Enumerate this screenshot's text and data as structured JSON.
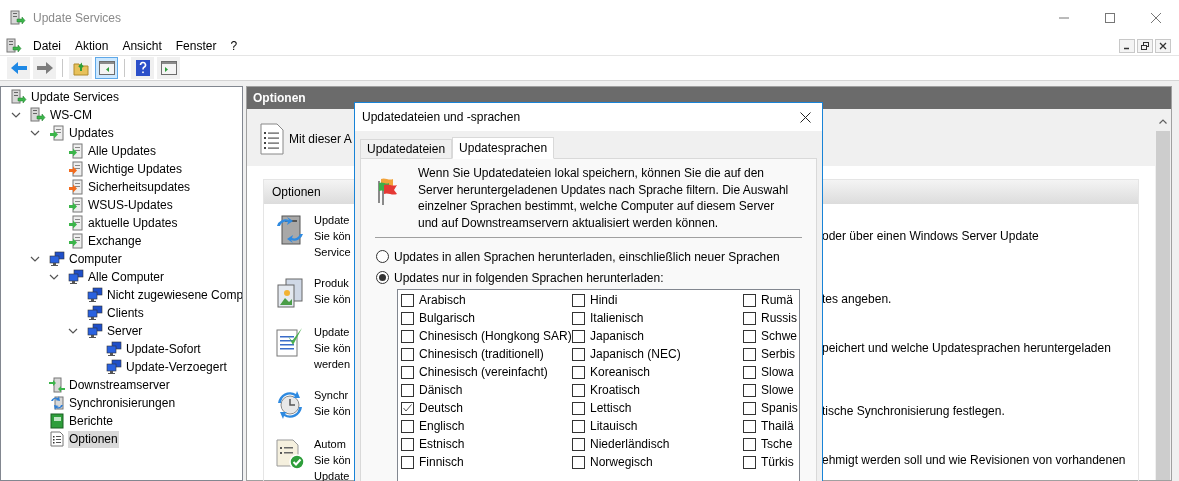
{
  "window": {
    "title": "Update Services"
  },
  "menu": [
    "Datei",
    "Aktion",
    "Ansicht",
    "Fenster",
    "?"
  ],
  "toolbar": [
    {
      "kind": "back",
      "pressed": false
    },
    {
      "kind": "forward",
      "pressed": false
    },
    {
      "kind": "sep"
    },
    {
      "kind": "up",
      "pressed": false
    },
    {
      "kind": "tree",
      "pressed": true
    },
    {
      "kind": "sep"
    },
    {
      "kind": "help",
      "pressed": false
    },
    {
      "kind": "pane",
      "pressed": false
    }
  ],
  "tree": [
    {
      "label": "Update Services",
      "kind": "server",
      "selected": false,
      "children": [
        {
          "label": "WS-CM",
          "kind": "server",
          "selected": false,
          "expanded": true,
          "children": [
            {
              "label": "Updates",
              "kind": "updates",
              "selected": false,
              "expanded": true,
              "children": [
                {
                  "label": "Alle Updates",
                  "kind": "all-updates",
                  "selected": false
                },
                {
                  "label": "Wichtige Updates",
                  "kind": "update-orange",
                  "selected": false
                },
                {
                  "label": "Sicherheitsupdates",
                  "kind": "update-orange",
                  "selected": false
                },
                {
                  "label": "WSUS-Updates",
                  "kind": "update-green",
                  "selected": false
                },
                {
                  "label": "aktuelle Updates",
                  "kind": "update-green",
                  "selected": false
                },
                {
                  "label": "Exchange",
                  "kind": "update-green",
                  "selected": false
                }
              ]
            },
            {
              "label": "Computer",
              "kind": "computers",
              "selected": false,
              "expanded": true,
              "children": [
                {
                  "label": "Alle Computer",
                  "kind": "computers",
                  "selected": false,
                  "expanded": true,
                  "children": [
                    {
                      "label": "Nicht zugewiesene Comp",
                      "kind": "computers",
                      "selected": false
                    },
                    {
                      "label": "Clients",
                      "kind": "computers",
                      "selected": false
                    },
                    {
                      "label": "Server",
                      "kind": "computers",
                      "selected": false,
                      "expanded": true,
                      "children": [
                        {
                          "label": "Update-Sofort",
                          "kind": "computers",
                          "selected": false
                        },
                        {
                          "label": "Update-Verzoegert",
                          "kind": "computers",
                          "selected": false
                        }
                      ]
                    }
                  ]
                }
              ]
            },
            {
              "label": "Downstreamserver",
              "kind": "downstream",
              "selected": false
            },
            {
              "label": "Synchronisierungen",
              "kind": "sync",
              "selected": false
            },
            {
              "label": "Berichte",
              "kind": "reports",
              "selected": false
            },
            {
              "label": "Optionen",
              "kind": "options",
              "selected": true
            }
          ]
        }
      ]
    }
  ],
  "pane": {
    "title": "Optionen",
    "intro": "Mit dieser A",
    "box_title": "Optionen",
    "items": [
      {
        "kind": "server",
        "left": [
          "Update",
          "Sie kön",
          "Service"
        ],
        "right": "oder über einen Windows Server Update"
      },
      {
        "kind": "products",
        "left": [
          "Produk",
          "Sie kön"
        ],
        "right": "tes angeben."
      },
      {
        "kind": "document",
        "left": [
          "Update",
          "Sie kön",
          "werden"
        ],
        "right": "peichert und welche Updatesprachen heruntergeladen"
      },
      {
        "kind": "sync",
        "left": [
          "Synchr",
          "Sie kön"
        ],
        "right": "tische Synchronisierung festlegen."
      },
      {
        "kind": "approve",
        "left": [
          "Autom",
          "Sie kön",
          "Update"
        ],
        "right": "ehmigt werden soll und wie Revisionen von vorhandenen"
      }
    ]
  },
  "dialog": {
    "title": "Updatedateien und -sprachen",
    "tabs": [
      {
        "label": "Updatedateien",
        "selected": false
      },
      {
        "label": "Updatesprachen",
        "selected": true
      }
    ],
    "description": "Wenn Sie Updatedateien lokal speichern, können Sie die auf den Server heruntergeladenen Updates nach Sprache filtern. Die Auswahl einzelner Sprachen bestimmt, welche Computer auf diesem Server und auf Downstreamservern aktualisiert werden können.",
    "options": [
      {
        "label": "Updates in allen Sprachen herunterladen, einschließlich neuer Sprachen",
        "selected": false
      },
      {
        "label": "Updates nur in folgenden Sprachen herunterladen:",
        "selected": true
      }
    ],
    "languages": [
      [
        {
          "label": "Arabisch",
          "checked": false
        },
        {
          "label": "Bulgarisch",
          "checked": false
        },
        {
          "label": "Chinesisch (Hongkong SAR)",
          "checked": false
        },
        {
          "label": "Chinesisch (traditionell)",
          "checked": false
        },
        {
          "label": "Chinesisch (vereinfacht)",
          "checked": false
        },
        {
          "label": "Dänisch",
          "checked": false
        },
        {
          "label": "Deutsch",
          "checked": true
        },
        {
          "label": "Englisch",
          "checked": false
        },
        {
          "label": "Estnisch",
          "checked": false
        },
        {
          "label": "Finnisch",
          "checked": false
        }
      ],
      [
        {
          "label": "Hindi",
          "checked": false
        },
        {
          "label": "Italienisch",
          "checked": false
        },
        {
          "label": "Japanisch",
          "checked": false
        },
        {
          "label": "Japanisch (NEC)",
          "checked": false
        },
        {
          "label": "Koreanisch",
          "checked": false
        },
        {
          "label": "Kroatisch",
          "checked": false
        },
        {
          "label": "Lettisch",
          "checked": false
        },
        {
          "label": "Litauisch",
          "checked": false
        },
        {
          "label": "Niederländisch",
          "checked": false
        },
        {
          "label": "Norwegisch",
          "checked": false
        }
      ],
      [
        {
          "label": "Rumä",
          "checked": false
        },
        {
          "label": "Russis",
          "checked": false
        },
        {
          "label": "Schwe",
          "checked": false
        },
        {
          "label": "Serbis",
          "checked": false
        },
        {
          "label": "Slowa",
          "checked": false
        },
        {
          "label": "Slowe",
          "checked": false
        },
        {
          "label": "Spanis",
          "checked": false
        },
        {
          "label": "Thailä",
          "checked": false
        },
        {
          "label": "Tsche",
          "checked": false
        },
        {
          "label": "Türkis",
          "checked": false
        }
      ]
    ]
  }
}
